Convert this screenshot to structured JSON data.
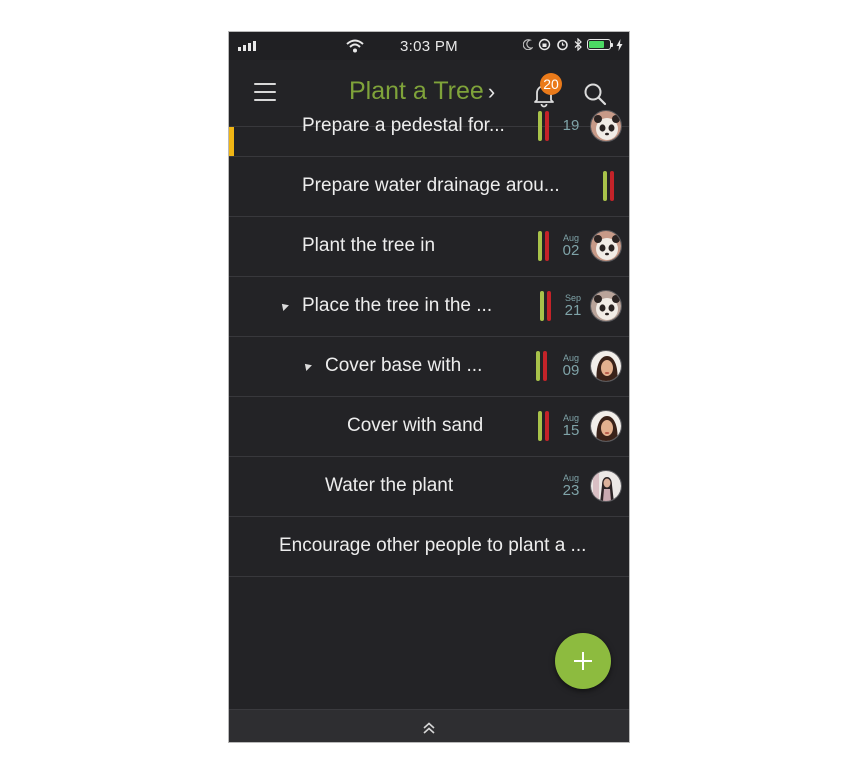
{
  "status_bar": {
    "time": "3:03 PM",
    "battery_level": 0.75,
    "battery_color": "#4cd964",
    "icons": [
      "signal-icon",
      "wifi-icon",
      "moon-icon",
      "rotation-lock-icon",
      "alarm-icon",
      "bluetooth-icon",
      "battery-icon",
      "charging-icon"
    ]
  },
  "header": {
    "title": "Plant a Tree",
    "title_chevron": "›",
    "title_color": "#7fa33a",
    "notification_count": "20",
    "badge_color": "#ea7a1a",
    "icons": [
      "menu-icon",
      "bell-icon",
      "search-icon"
    ]
  },
  "tasks": [
    {
      "title": "Prepare a pedestal for...",
      "priority_bars": [
        "green",
        "red"
      ],
      "date_month": "",
      "date_day": "19",
      "avatar": "panda",
      "active": true
    },
    {
      "title": "Prepare water drainage arou...",
      "priority_bars": [
        "green",
        "red"
      ],
      "date_month": "",
      "date_day": "",
      "avatar": ""
    },
    {
      "title": "Plant the tree in",
      "priority_bars": [
        "green",
        "red"
      ],
      "date_month": "Aug",
      "date_day": "02",
      "avatar": "panda"
    },
    {
      "title": "Place the tree in the ...",
      "priority_bars": [
        "green",
        "red"
      ],
      "date_month": "Sep",
      "date_day": "21",
      "avatar": "panda",
      "expanded": true
    },
    {
      "title": "Cover base with ...",
      "priority_bars": [
        "green",
        "red"
      ],
      "date_month": "Aug",
      "date_day": "09",
      "avatar": "woman",
      "expanded": true
    },
    {
      "title": "Cover with sand",
      "priority_bars": [
        "green",
        "red"
      ],
      "date_month": "Aug",
      "date_day": "15",
      "avatar": "woman"
    },
    {
      "title": "Water the plant",
      "priority_bars": [],
      "date_month": "Aug",
      "date_day": "23",
      "avatar": "person"
    },
    {
      "title": "Encourage other people to plant a ...",
      "priority_bars": [],
      "date_month": "",
      "date_day": "",
      "avatar": ""
    }
  ],
  "colors": {
    "priority_green": "#a8c24a",
    "priority_red": "#c42329",
    "fab": "#8dbb3f",
    "active_marker": "#f0b514",
    "background": "#232326"
  },
  "fab": {
    "icon": "plus-icon"
  },
  "bottom_bar": {
    "icon": "double-chevron-up-icon"
  }
}
